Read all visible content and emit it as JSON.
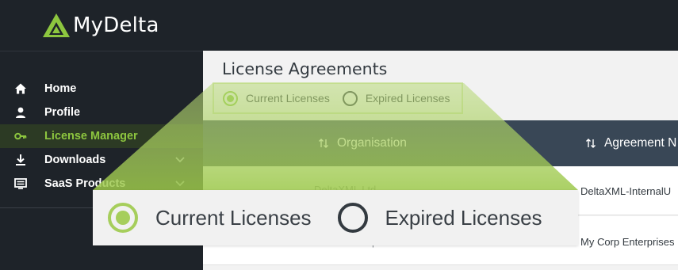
{
  "brand": {
    "name": "MyDelta",
    "accent": "#8dc63f"
  },
  "sidebar": {
    "items": [
      {
        "label": "Home",
        "icon": "home-icon"
      },
      {
        "label": "Profile",
        "icon": "user-icon"
      },
      {
        "label": "License Manager",
        "icon": "key-icon",
        "active": true
      },
      {
        "label": "Downloads",
        "icon": "download-icon",
        "expandable": true
      },
      {
        "label": "SaaS Products",
        "icon": "monitor-icon",
        "expandable": true
      }
    ]
  },
  "page": {
    "title": "License Agreements",
    "filter": {
      "options": [
        "Current Licenses",
        "Expired Licenses"
      ],
      "selected": "Current Licenses"
    }
  },
  "table": {
    "columns": [
      "Organisation",
      "Agreement N"
    ],
    "rows": [
      {
        "organisation": "DeltaXML Ltd",
        "agreement": "DeltaXML-InternalU"
      },
      {
        "organisation": "Universal Exports",
        "agreement": "My Corp Enterprises"
      }
    ]
  },
  "zoom_callout": {
    "options": [
      "Current Licenses",
      "Expired Licenses"
    ],
    "selected": "Current Licenses"
  }
}
